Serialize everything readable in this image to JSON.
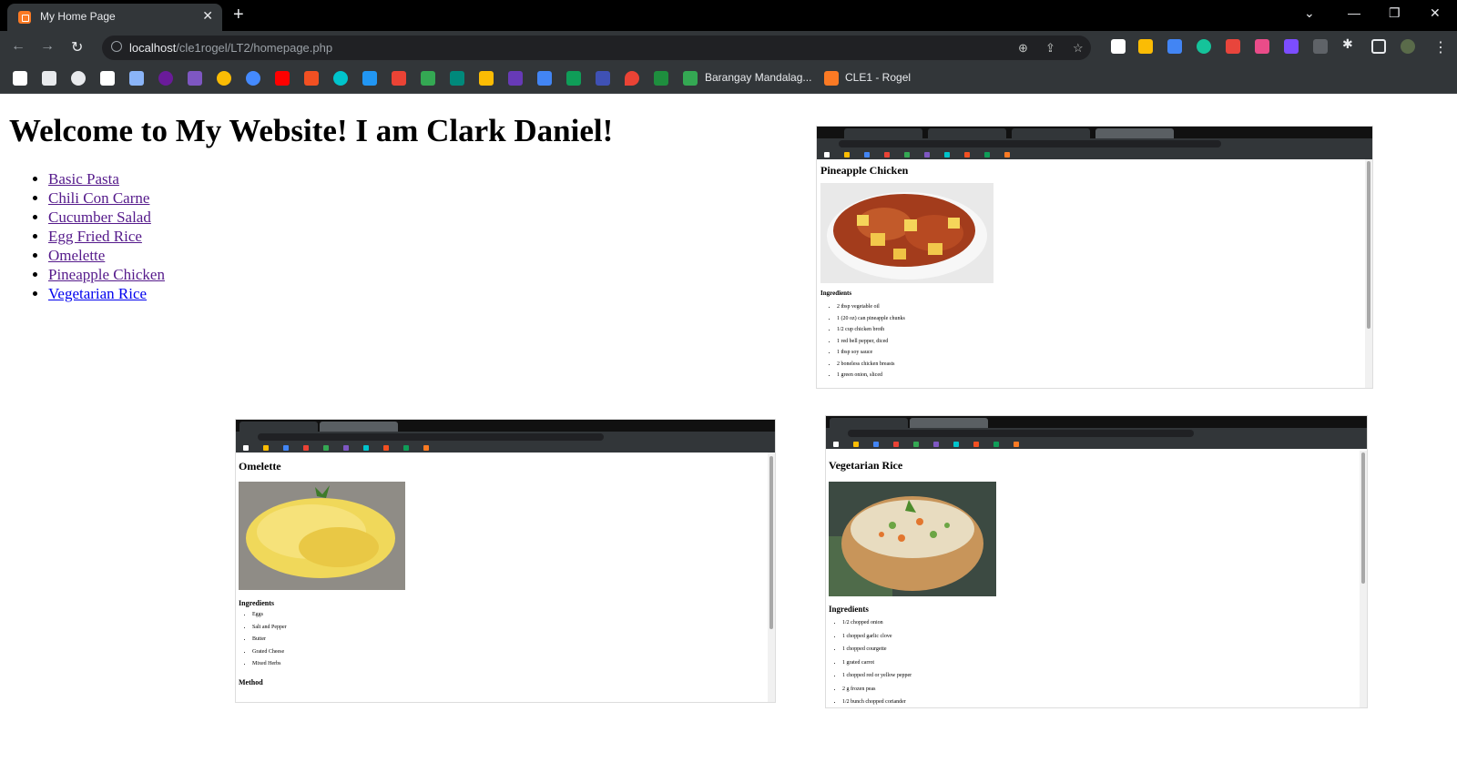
{
  "browser": {
    "tab_title": "My Home Page",
    "url_host": "localhost",
    "url_path": "/cle1rogel/LT2/homepage.php",
    "bookmarks": [
      {
        "label": "Barangay Mandalag..."
      },
      {
        "label": "CLE1 - Rogel"
      }
    ],
    "colors": {
      "tabbar": "#000000",
      "toolbar": "#323639",
      "omnibox": "#202124"
    }
  },
  "page": {
    "heading": "Welcome to My Website! I am Clark Daniel!",
    "recipes": [
      "Basic Pasta",
      "Chili Con Carne",
      "Cucumber Salad",
      "Egg Fried Rice",
      "Omelette",
      "Pineapple Chicken",
      "Vegetarian Rice"
    ]
  },
  "screenshots": {
    "pineapple": {
      "title": "Pineapple Chicken",
      "subheading": "Ingredients",
      "items": [
        "2 tbsp vegetable oil",
        "1 (20 oz) can pineapple chunks",
        "1/2 cup chicken broth",
        "1 red bell pepper, diced",
        "1 tbsp soy sauce",
        "2 boneless chicken breasts",
        "1 green onion, sliced"
      ]
    },
    "omelette": {
      "title": "Omelette",
      "subheading": "Ingredients",
      "items": [
        "Eggs",
        "Salt and Pepper",
        "Butter",
        "Grated Cheese",
        "Mixed Herbs"
      ],
      "method_heading": "Method"
    },
    "vegetarian": {
      "title": "Vegetarian Rice",
      "subheading": "Ingredients",
      "items": [
        "1/2 chopped onion",
        "1 chopped garlic clove",
        "1 chopped courgette",
        "1 grated carrot",
        "1 chopped red or yellow pepper",
        "2 g frozen peas",
        "1/2 bunch chopped coriander"
      ]
    }
  }
}
